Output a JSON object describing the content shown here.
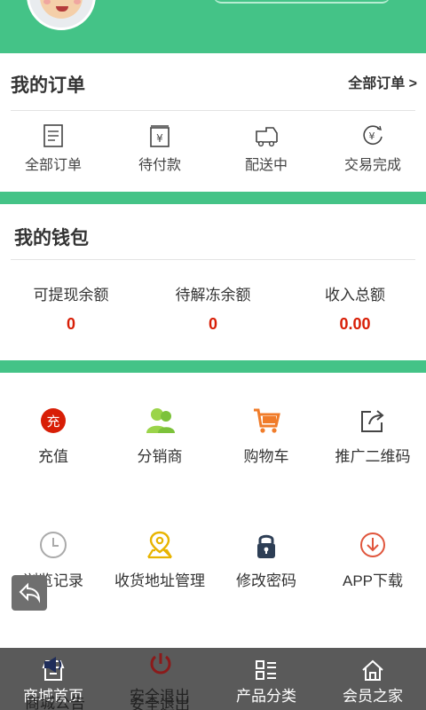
{
  "colors": {
    "brand_green": "#44c387",
    "value_red": "#d81e06",
    "nav_bg": "#5a5a5a"
  },
  "orders": {
    "title": "我的订单",
    "all_link": "全部订单 >",
    "items": [
      {
        "label": "全部订单",
        "icon": "document-icon"
      },
      {
        "label": "待付款",
        "icon": "payment-icon"
      },
      {
        "label": "配送中",
        "icon": "truck-icon"
      },
      {
        "label": "交易完成",
        "icon": "exchange-complete-icon"
      }
    ]
  },
  "wallet": {
    "title": "我的钱包",
    "items": [
      {
        "label": "可提现余额",
        "value": "0"
      },
      {
        "label": "待解冻余额",
        "value": "0"
      },
      {
        "label": "收入总额",
        "value": "0.00"
      }
    ]
  },
  "grid": {
    "items": [
      {
        "label": "充值",
        "icon": "recharge-icon",
        "icon_text": "充"
      },
      {
        "label": "分销商",
        "icon": "distributor-icon"
      },
      {
        "label": "购物车",
        "icon": "cart-icon"
      },
      {
        "label": "推广二维码",
        "icon": "share-icon"
      },
      {
        "label": "浏览记录",
        "icon": "clock-icon"
      },
      {
        "label": "收货地址管理",
        "icon": "location-icon"
      },
      {
        "label": "修改密码",
        "icon": "lock-icon"
      },
      {
        "label": "APP下载",
        "icon": "download-icon"
      }
    ]
  },
  "bottom_nav": {
    "items": [
      {
        "label": "商城首页",
        "icon": "store-icon"
      },
      {
        "label": "安全退出",
        "icon": "power-icon"
      },
      {
        "label": "产品分类",
        "icon": "category-icon"
      },
      {
        "label": "会员之家",
        "icon": "home-icon"
      }
    ],
    "ghost_labels": [
      "商城公告",
      "安全退出"
    ]
  }
}
